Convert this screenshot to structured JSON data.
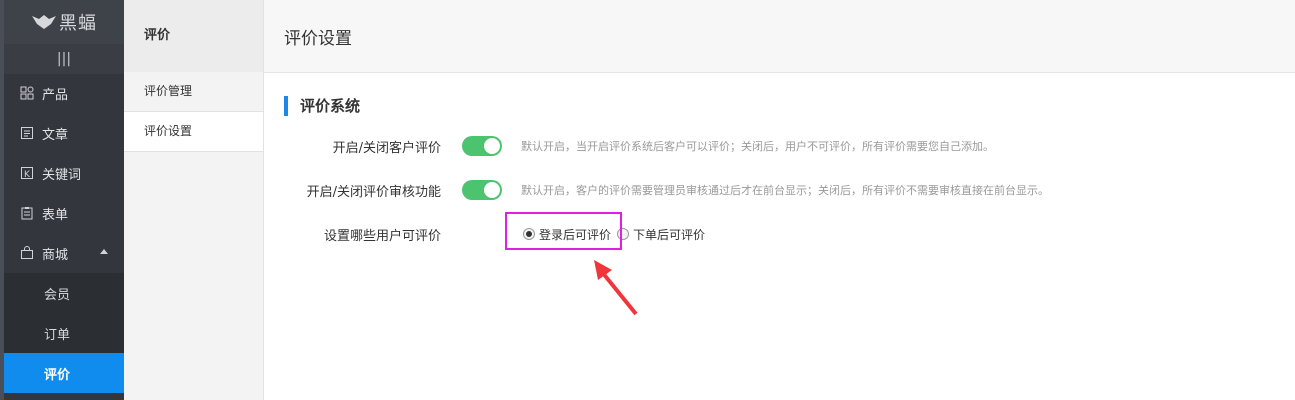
{
  "brand": {
    "name": "黑蝠",
    "logo_icon": "bat-logo-icon"
  },
  "sidebar": {
    "collapse_icon": "menu-lines-icon",
    "items": [
      {
        "label": "产品",
        "icon": "grid-icon"
      },
      {
        "label": "文章",
        "icon": "document-icon"
      },
      {
        "label": "关键词",
        "icon": "k-box-icon"
      },
      {
        "label": "表单",
        "icon": "clipboard-icon"
      },
      {
        "label": "商城",
        "icon": "shopping-bag-icon",
        "expanded": true
      }
    ],
    "subitems": [
      {
        "label": "会员"
      },
      {
        "label": "订单"
      },
      {
        "label": "评价",
        "active": true
      }
    ]
  },
  "submenu": {
    "title": "评价",
    "items": [
      {
        "label": "评价管理"
      },
      {
        "label": "评价设置",
        "active": true
      }
    ]
  },
  "main": {
    "page_title": "评价设置",
    "section_title": "评价系统",
    "settings": [
      {
        "label": "开启/关闭客户评价",
        "enabled": true,
        "hint": "默认开启，当开启评价系统后客户可以评价；关闭后，用户不可评价，所有评价需要您自己添加。"
      },
      {
        "label": "开启/关闭评价审核功能",
        "enabled": true,
        "hint": "默认开启，客户的评价需要管理员审核通过后才在前台显示；关闭后，所有评价不需要审核直接在前台显示。"
      }
    ],
    "who_can_review": {
      "label": "设置哪些用户可评价",
      "options": [
        {
          "label": "登录后可评价",
          "checked": true
        },
        {
          "label": "下单后可评价",
          "checked": false
        }
      ]
    }
  },
  "colors": {
    "accent": "#108cee",
    "toggle_on": "#4cc36e",
    "highlight": "#e020e0",
    "arrow": "#f0363a"
  }
}
